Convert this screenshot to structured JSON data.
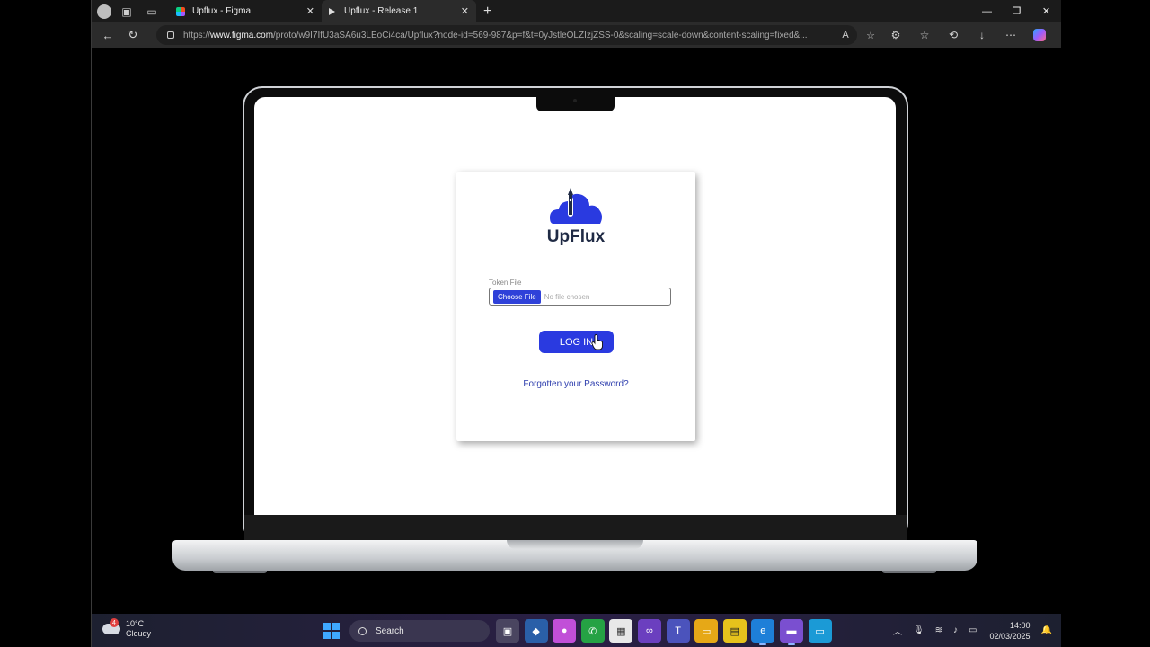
{
  "browser": {
    "tabs": [
      {
        "title": "Upflux - Figma",
        "active": false
      },
      {
        "title": "Upflux - Release 1",
        "active": true
      }
    ],
    "url_prefix": "https://",
    "url_host": "www.figma.com",
    "url_path": "/proto/w9I7IfU3aSA6u3LEoCi4ca/Upflux?node-id=569-987&p=f&t=0yJstleOLZIzjZSS-0&scaling=scale-down&content-scaling=fixed&..."
  },
  "login": {
    "brand": "UpFlux",
    "token_label": "Token File",
    "choose_file": "Choose File",
    "no_file": "No file chosen",
    "login_button": "LOG IN",
    "forgot_link": "Forgotten your Password?",
    "brand_color": "#2a3ae0"
  },
  "taskbar": {
    "weather_temp": "10°C",
    "weather_desc": "Cloudy",
    "weather_badge": "4",
    "search_placeholder": "Search",
    "time": "14:00",
    "date": "02/03/2025"
  }
}
